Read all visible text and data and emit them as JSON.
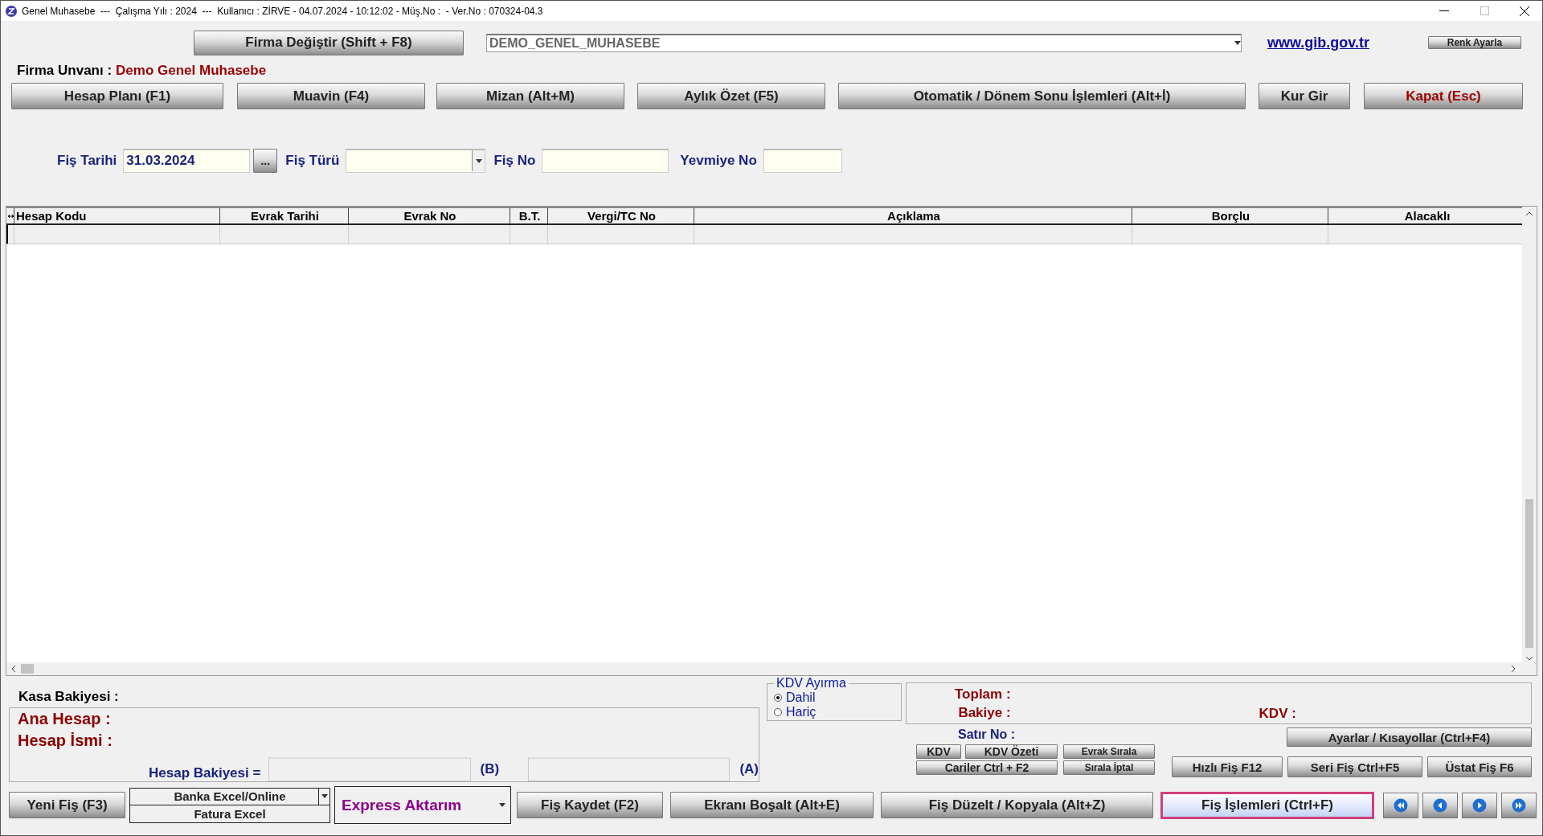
{
  "window": {
    "title": "Genel Muhasebe  ---  Çalışma Yılı : 2024  ---  Kullanıcı : ZİRVE - 04.07.2024 - 10:12:02 - Müş.No :  - Ver.No : 070324-04.3"
  },
  "toolbar": {
    "firma_button": "Firma Değiştir (Shift + F8)",
    "company_select": "DEMO_GENEL_MUHASEBE",
    "link": "www.gib.gov.tr",
    "color_button": "Renk Ayarla"
  },
  "company": {
    "label": "Firma Unvanı :",
    "value": "Demo Genel Muhasebe"
  },
  "menu_buttons": [
    {
      "label": "Hesap Planı (F1)",
      "kind": "normal"
    },
    {
      "label": "Muavin (F4)",
      "kind": "normal"
    },
    {
      "label": "Mizan (Alt+M)",
      "kind": "normal"
    },
    {
      "label": "Aylık Özet (F5)",
      "kind": "normal"
    },
    {
      "label": "Otomatik / Dönem Sonu İşlemleri (Alt+İ)",
      "kind": "normal"
    },
    {
      "label": "Kur Gir",
      "kind": "normal"
    },
    {
      "label": "Kapat (Esc)",
      "kind": "close"
    }
  ],
  "form": {
    "fields": [
      {
        "label": "Fiş Tarihi",
        "value": "31.03.2024",
        "kind": "date",
        "button": "..."
      },
      {
        "label": "Fiş Türü",
        "kind": "select"
      },
      {
        "label": "Fiş No",
        "kind": "text"
      },
      {
        "label": "Yevmiye No",
        "kind": "text"
      }
    ]
  },
  "table": {
    "columns": [
      "Hesap Kodu",
      "Evrak Tarihi",
      "Evrak No",
      "B.T.",
      "Vergi/TC No",
      "Açıklama",
      "Borçlu",
      "Alacaklı"
    ]
  },
  "summary": {
    "kasa": "Kasa Bakiyesi :",
    "ana_hesap": "Ana Hesap :",
    "hesap_ismi": "Hesap İsmi :",
    "hesap_bakiyesi": "Hesap Bakiyesi =",
    "b": "(B)",
    "a": "(A)"
  },
  "kdv_ayirma": {
    "title": "KDV Ayırma",
    "options": [
      {
        "label": "Dahil",
        "selected": true
      },
      {
        "label": "Hariç",
        "selected": false
      }
    ]
  },
  "totals": {
    "toplam": "Toplam :",
    "bakiye": "Bakiye :",
    "kdv": "KDV :"
  },
  "satir_no": "Satır No :",
  "small_buttons": {
    "kdv": "KDV",
    "kdv_ozeti": "KDV Özeti",
    "cariler": "Cariler Ctrl + F2",
    "evrak_sirala": "Evrak Sırala",
    "sirala_iptal": "Sırala İptal"
  },
  "shortcuts": {
    "settings": "Ayarlar / Kısayollar (Ctrl+F4)",
    "row": [
      "Hızlı Fiş F12",
      "Seri Fiş Ctrl+F5",
      "Üstat Fiş F6"
    ]
  },
  "bottom": {
    "new_button": "Yeni Fiş (F3)",
    "import_options": [
      "Banka Excel/Online",
      "Fatura Excel"
    ],
    "express": "Express Aktarım",
    "actions": [
      {
        "label": "Fiş Kaydet (F2)",
        "focused": false
      },
      {
        "label": "Ekranı Boşalt (Alt+E)",
        "focused": false
      },
      {
        "label": "Fiş Düzelt / Kopyala (Alt+Z)",
        "focused": false
      },
      {
        "label": "Fiş İşlemleri (Ctrl+F)",
        "focused": true
      }
    ]
  }
}
